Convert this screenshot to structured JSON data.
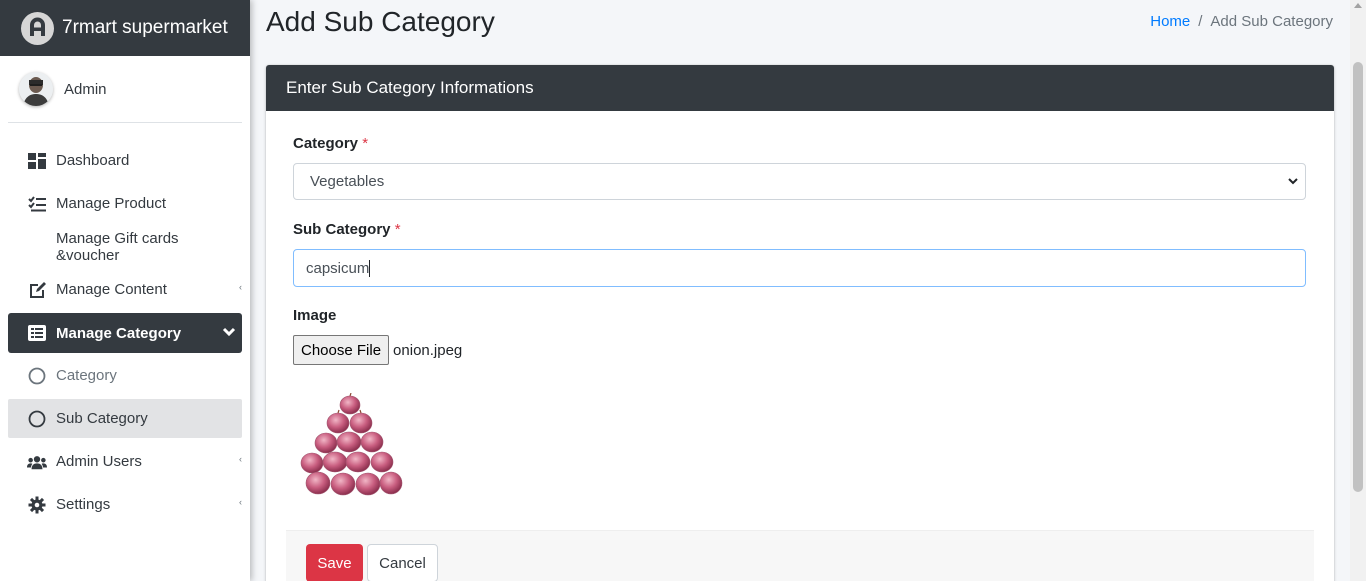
{
  "brand": {
    "name": "7rmart supermarket",
    "logo_icon": "brand-logo-icon"
  },
  "user": {
    "name": "Admin"
  },
  "sidebar": {
    "items": [
      {
        "label": "Dashboard",
        "icon": "dashboard-icon"
      },
      {
        "label": "Manage Product",
        "icon": "list-check-icon"
      },
      {
        "label": "Manage Gift cards &voucher"
      },
      {
        "label": "Manage Content",
        "icon": "edit-icon"
      },
      {
        "label": "Manage Category",
        "icon": "list-alt-icon"
      },
      {
        "label": "Category",
        "icon": "circle-icon"
      },
      {
        "label": "Sub Category",
        "icon": "circle-icon"
      },
      {
        "label": "Admin Users",
        "icon": "users-icon"
      },
      {
        "label": "Settings",
        "icon": "gear-icon"
      }
    ]
  },
  "header": {
    "title": "Add Sub Category",
    "breadcrumb": {
      "home": "Home",
      "separator": "/",
      "current": "Add Sub Category"
    }
  },
  "card": {
    "title": "Enter Sub Category Informations",
    "category_label": "Category",
    "required_mark": "*",
    "category_value": "Vegetables",
    "subcategory_label": "Sub Category",
    "subcategory_value": "capsicum",
    "image_label": "Image",
    "file_button": "Choose File",
    "file_name": "onion.jpeg"
  },
  "footer": {
    "save": "Save",
    "cancel": "Cancel"
  },
  "colors": {
    "dark": "#343a40",
    "danger": "#dc3545",
    "link": "#007bff",
    "focus": "#80bdff"
  }
}
